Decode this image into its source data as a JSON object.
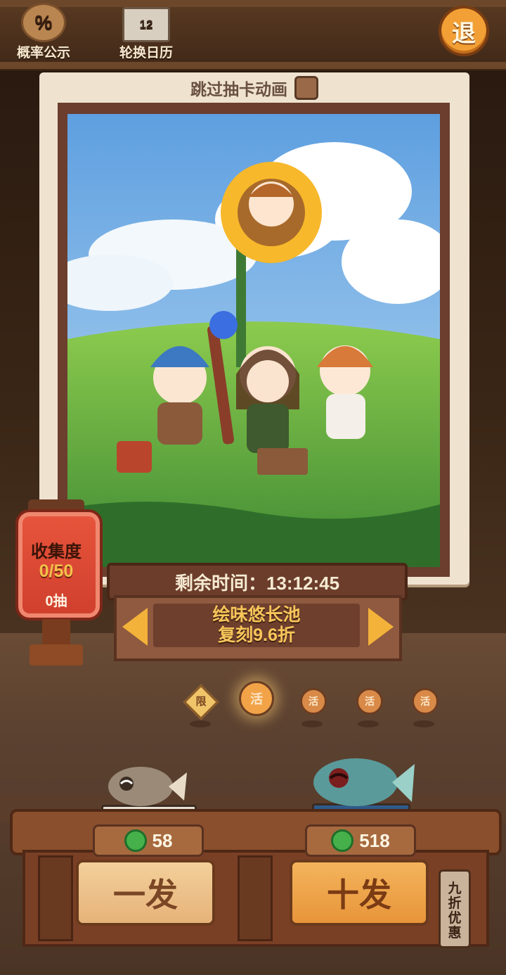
{
  "top_bar": {
    "probability": {
      "icon_text": "%",
      "label": "概率公示"
    },
    "calendar": {
      "icon_text": "12",
      "label": "轮换日历"
    },
    "exit": {
      "label": "退"
    }
  },
  "skip_animation": {
    "label": "跳过抽卡动画",
    "checked": false
  },
  "collection": {
    "title": "收集度",
    "progress": "0/50",
    "draws": "0抽"
  },
  "timer": {
    "label": "剩余时间：13:12:45"
  },
  "pool": {
    "name": "绘味悠长池",
    "subtitle": "复刻9.6折"
  },
  "pool_selector": {
    "limited_label": "限",
    "items": [
      "活",
      "活",
      "活",
      "活"
    ],
    "selected_index": 0
  },
  "draw": {
    "single": {
      "label": "一发",
      "cost": "58"
    },
    "ten": {
      "label": "十发",
      "cost": "518"
    },
    "discount_tag": "九折优惠"
  },
  "colors": {
    "accent": "#f3b23a",
    "frame": "#efe3d0",
    "currency": "#46b04a"
  }
}
